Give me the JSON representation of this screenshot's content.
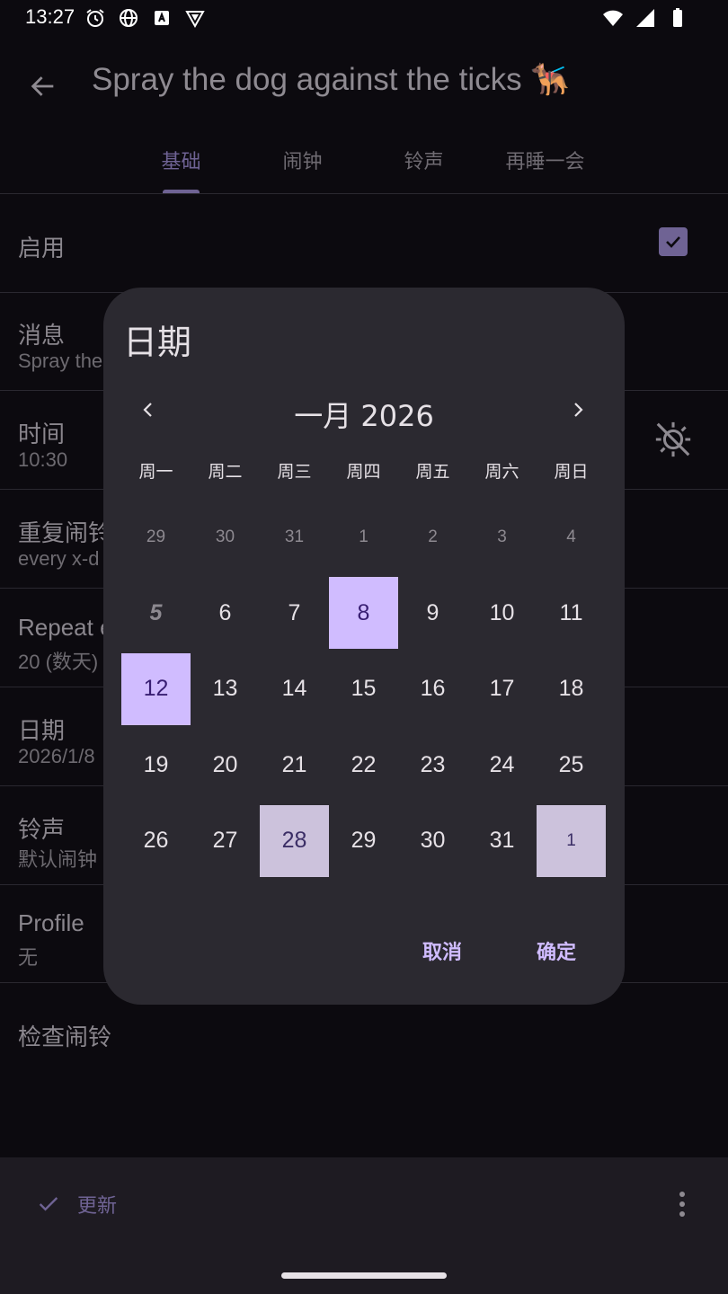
{
  "status_bar": {
    "time": "13:27",
    "left_icons": [
      "alarm-icon",
      "globe-icon",
      "a-icon",
      "vpn-shield-icon"
    ],
    "right_icons": [
      "wifi-icon",
      "signal-icon",
      "battery-icon"
    ]
  },
  "app_bar": {
    "title": "Spray the dog against the ticks 🐕‍🦺"
  },
  "tabs": [
    {
      "label": "基础",
      "active": true
    },
    {
      "label": "闹钟",
      "active": false
    },
    {
      "label": "铃声",
      "active": false
    },
    {
      "label": "再睡一会",
      "active": false
    }
  ],
  "settings": {
    "enabled": {
      "title": "启用",
      "checked": true
    },
    "message": {
      "title": "消息",
      "value": "Spray the"
    },
    "time": {
      "title": "时间",
      "value": "10:30"
    },
    "repeat": {
      "title": "重复闹铃",
      "value": "every x-d"
    },
    "repeat_every": {
      "title": "Repeat e",
      "value": "20 (数天)"
    },
    "date": {
      "title": "日期",
      "value": "2026/1/8"
    },
    "ringtone": {
      "title": "铃声",
      "value": "默认闹钟"
    },
    "profile": {
      "title": "Profile",
      "value": "无"
    },
    "check": {
      "title": "检查闹铃"
    }
  },
  "bottom_bar": {
    "update_label": "更新"
  },
  "date_dialog": {
    "title": "日期",
    "month_label": "一月 2026",
    "weekdays": [
      "周一",
      "周二",
      "周三",
      "周四",
      "周五",
      "周六",
      "周日"
    ],
    "weeks": [
      [
        {
          "d": "29",
          "t": "out"
        },
        {
          "d": "30",
          "t": "out"
        },
        {
          "d": "31",
          "t": "out"
        },
        {
          "d": "1",
          "t": "out"
        },
        {
          "d": "2",
          "t": "out"
        },
        {
          "d": "3",
          "t": "out"
        },
        {
          "d": "4",
          "t": "out"
        }
      ],
      [
        {
          "d": "5",
          "t": "today"
        },
        {
          "d": "6",
          "t": ""
        },
        {
          "d": "7",
          "t": ""
        },
        {
          "d": "8",
          "t": "sel"
        },
        {
          "d": "9",
          "t": ""
        },
        {
          "d": "10",
          "t": ""
        },
        {
          "d": "11",
          "t": ""
        }
      ],
      [
        {
          "d": "12",
          "t": "sel"
        },
        {
          "d": "13",
          "t": ""
        },
        {
          "d": "14",
          "t": ""
        },
        {
          "d": "15",
          "t": ""
        },
        {
          "d": "16",
          "t": ""
        },
        {
          "d": "17",
          "t": ""
        },
        {
          "d": "18",
          "t": ""
        }
      ],
      [
        {
          "d": "19",
          "t": ""
        },
        {
          "d": "20",
          "t": ""
        },
        {
          "d": "21",
          "t": ""
        },
        {
          "d": "22",
          "t": ""
        },
        {
          "d": "23",
          "t": ""
        },
        {
          "d": "24",
          "t": ""
        },
        {
          "d": "25",
          "t": ""
        }
      ],
      [
        {
          "d": "26",
          "t": ""
        },
        {
          "d": "27",
          "t": ""
        },
        {
          "d": "28",
          "t": "range"
        },
        {
          "d": "29",
          "t": ""
        },
        {
          "d": "30",
          "t": ""
        },
        {
          "d": "31",
          "t": ""
        },
        {
          "d": "1",
          "t": "out range"
        }
      ]
    ],
    "cancel_label": "取消",
    "ok_label": "确定"
  }
}
